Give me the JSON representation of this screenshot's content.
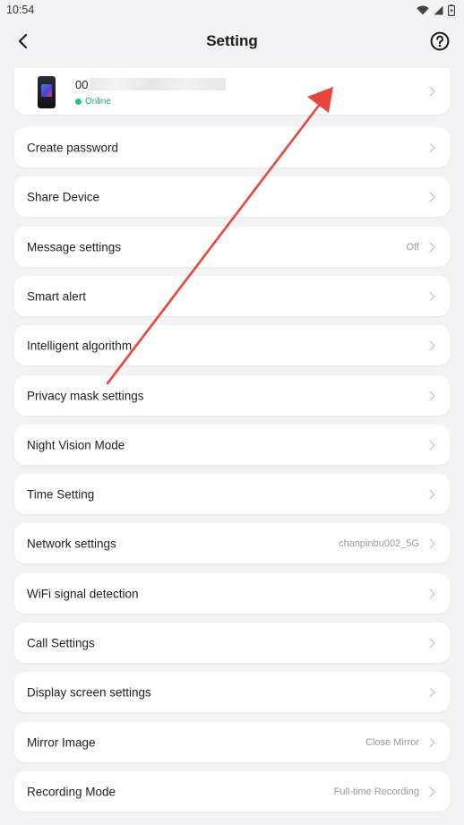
{
  "status_bar": {
    "time": "10:54"
  },
  "header": {
    "title": "Setting"
  },
  "device": {
    "name_prefix": "00",
    "status": "Online"
  },
  "settings": [
    {
      "label": "Create password",
      "value": ""
    },
    {
      "label": "Share Device",
      "value": ""
    },
    {
      "label": "Message settings",
      "value": "Off"
    },
    {
      "label": "Smart alert",
      "value": ""
    },
    {
      "label": "Intelligent algorithm",
      "value": ""
    },
    {
      "label": "Privacy mask settings",
      "value": ""
    },
    {
      "label": "Night Vision Mode",
      "value": ""
    },
    {
      "label": "Time Setting",
      "value": ""
    },
    {
      "label": "Network settings",
      "value": "chanpinbu002_5G"
    },
    {
      "label": "WiFi signal detection",
      "value": ""
    },
    {
      "label": "Call Settings",
      "value": ""
    },
    {
      "label": "Display screen settings",
      "value": ""
    },
    {
      "label": "Mirror Image",
      "value": "Close Mirror"
    },
    {
      "label": "Recording Mode",
      "value": "Full-time Recording"
    }
  ],
  "colors": {
    "background": "#f3f3f5",
    "online": "#26c281",
    "annotation_arrow": "#e8453c"
  },
  "icons": {
    "back": "chevron-left-icon",
    "help": "question-circle-icon",
    "wifi": "wifi-icon",
    "cellular": "cellular-signal-icon",
    "battery": "battery-charging-icon"
  }
}
